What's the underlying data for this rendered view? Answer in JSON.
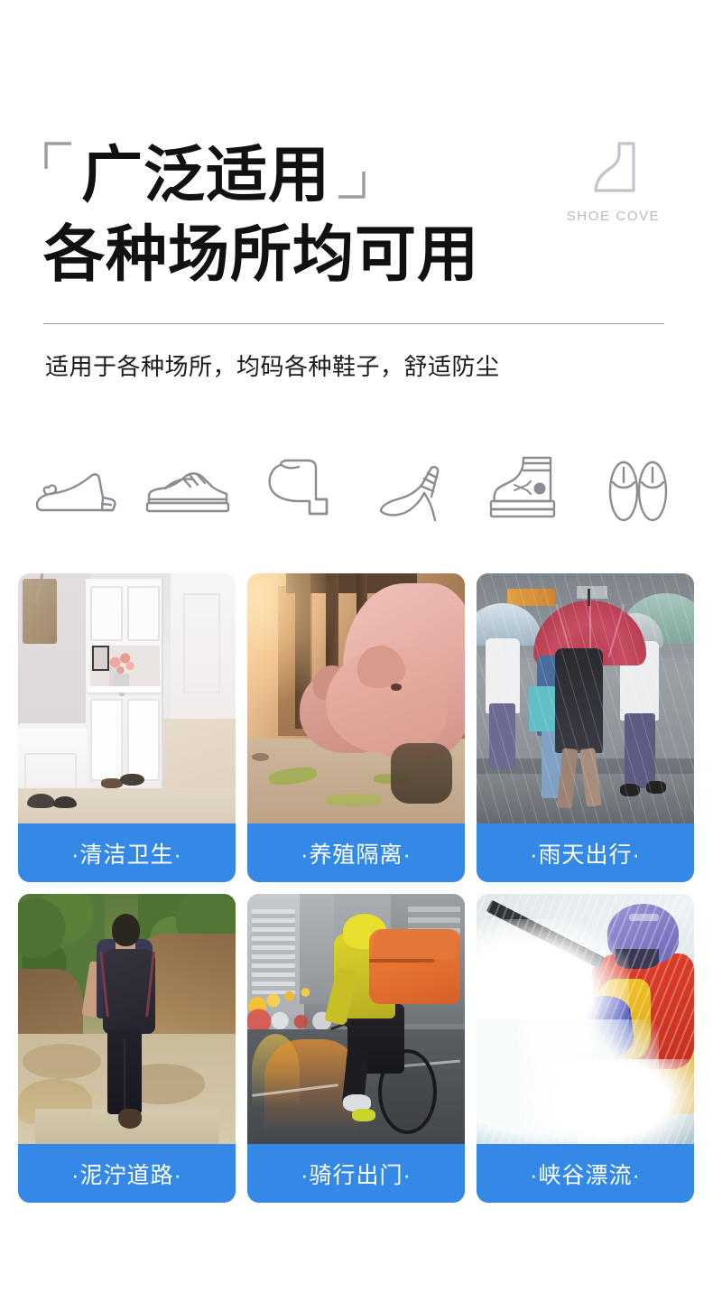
{
  "brand": {
    "name": "SHOE COVE",
    "logo_icon": "boot-outline-icon"
  },
  "header": {
    "bracket_open": "「",
    "bracket_close": "」",
    "title_line1": "广泛适用",
    "title_line2": "各种场所均可用",
    "subtitle": "适用于各种场所，均码各种鞋子，舒适防尘"
  },
  "shoe_icons": [
    {
      "name": "flat-shoe-icon",
      "label": "平底鞋"
    },
    {
      "name": "sneaker-icon",
      "label": "运动鞋"
    },
    {
      "name": "ankle-boot-icon",
      "label": "短靴"
    },
    {
      "name": "high-heel-icon",
      "label": "高跟鞋"
    },
    {
      "name": "work-boot-icon",
      "label": "工作靴"
    },
    {
      "name": "slippers-icon",
      "label": "拖鞋"
    }
  ],
  "scenarios": [
    {
      "caption": "·清洁卫生·",
      "scene": "entryway",
      "alt": "现代白色门厅鞋柜与鞋子"
    },
    {
      "caption": "·养殖隔离·",
      "scene": "pigfarm",
      "alt": "猪舍内的猪"
    },
    {
      "caption": "·雨天出行·",
      "scene": "rainstreet",
      "alt": "雨中撑伞过马路的行人"
    },
    {
      "caption": "·泥泞道路·",
      "scene": "muddyroad",
      "alt": "背包客行走在泥泞山路"
    },
    {
      "caption": "·骑行出门·",
      "scene": "cyclist",
      "alt": "雨天城市街道骑行者"
    },
    {
      "caption": "·峡谷漂流·",
      "scene": "rafting",
      "alt": "白水漂流皮艇运动员"
    }
  ],
  "colors": {
    "accent_blue": "#3488e6",
    "title_black": "#111111",
    "brand_gray": "#b9bbc2",
    "icon_gray": "#888a8f",
    "divider_gray": "#9a9a9e"
  }
}
